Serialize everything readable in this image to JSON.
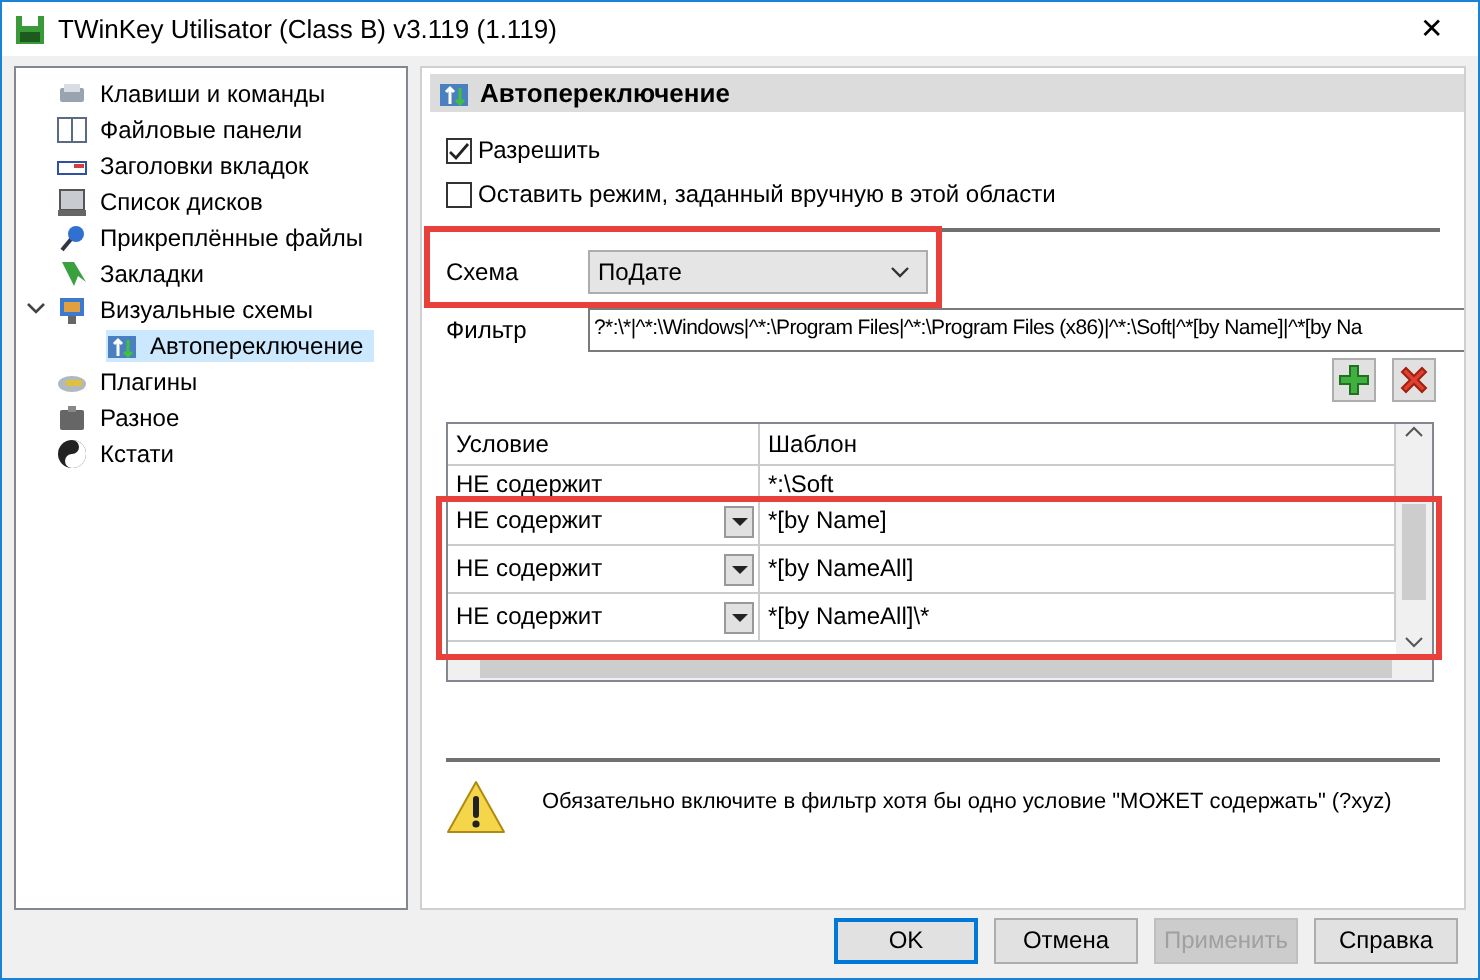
{
  "window": {
    "title": "TWinKey Utilisator (Class B) v3.119 (1.119)",
    "close": "✕"
  },
  "sidebar": {
    "items": [
      {
        "label": "Клавиши и команды",
        "selected": false
      },
      {
        "label": "Файловые панели",
        "selected": false
      },
      {
        "label": "Заголовки вкладок",
        "selected": false
      },
      {
        "label": "Список дисков",
        "selected": false
      },
      {
        "label": "Прикреплённые файлы",
        "selected": false
      },
      {
        "label": "Закладки",
        "selected": false
      },
      {
        "label": "Визуальные схемы",
        "selected": false,
        "expanded": true,
        "children": [
          {
            "label": "Автопереключение",
            "selected": true
          }
        ]
      },
      {
        "label": "Плагины",
        "selected": false
      },
      {
        "label": "Разное",
        "selected": false
      },
      {
        "label": "Кстати",
        "selected": false
      }
    ]
  },
  "panel": {
    "title": "Автопереключение",
    "checkboxes": [
      {
        "label": "Разрешить",
        "checked": true
      },
      {
        "label": "Оставить режим, заданный вручную в этой области",
        "checked": false
      }
    ],
    "scheme": {
      "label": "Схема",
      "value": "ПоДате"
    },
    "filter": {
      "label": "Фильтр",
      "value": "?*:\\*|^*:\\Windows|^*:\\Program Files|^*:\\Program Files (x86)|^*:\\Soft|^*[by Name]|^*[by Na"
    },
    "table": {
      "columns": [
        "Условие",
        "Шаблон"
      ],
      "rows": [
        {
          "condition": "НЕ содержит",
          "pattern": "*:\\Soft",
          "clipped": true
        },
        {
          "condition": "НЕ содержит",
          "pattern": "*[by Name]",
          "clipped": false
        },
        {
          "condition": "НЕ содержит",
          "pattern": "*[by NameAll]",
          "clipped": false
        },
        {
          "condition": "НЕ содержит",
          "pattern": "*[by NameAll]\\*",
          "clipped": false
        }
      ]
    },
    "warning": "Обязательно включите в фильтр хотя бы одно условие \"МОЖЕТ содержать\" (?xyz)"
  },
  "buttons": [
    {
      "label": "OK",
      "default": true,
      "disabled": false
    },
    {
      "label": "Отмена",
      "default": false,
      "disabled": false
    },
    {
      "label": "Применить",
      "default": false,
      "disabled": true
    },
    {
      "label": "Справка",
      "default": false,
      "disabled": false
    }
  ]
}
